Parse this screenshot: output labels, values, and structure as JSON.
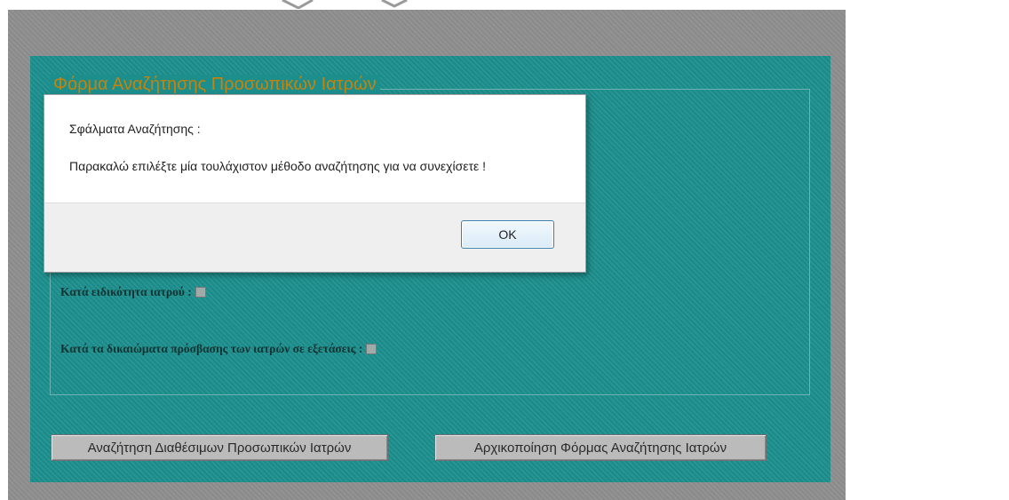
{
  "form": {
    "legend": "Φόρμα Αναζήτησης Προσωπικών Ιατρών",
    "criteria": [
      {
        "label": "Κατά ειδικότητα ιατρού :"
      },
      {
        "label": "Κατά τα δικαιώματα πρόσβασης των ιατρών σε εξετάσεις :"
      }
    ],
    "buttons": {
      "search": "Αναζήτηση Διαθέσιμων Προσωπικών Ιατρών",
      "reset": "Αρχικοποίηση Φόρμας Αναζήτησης Ιατρών"
    }
  },
  "dialog": {
    "title": "Σφάλματα Αναζήτησης :",
    "message": "Παρακαλώ επιλέξτε μία τουλάχιστον μέθοδο αναζήτησης για να συνεχίσετε !",
    "ok_label": "OK"
  },
  "colors": {
    "panel": "#1c8f8d",
    "legend": "#c8820a",
    "overlay": "#8f8f8f"
  }
}
